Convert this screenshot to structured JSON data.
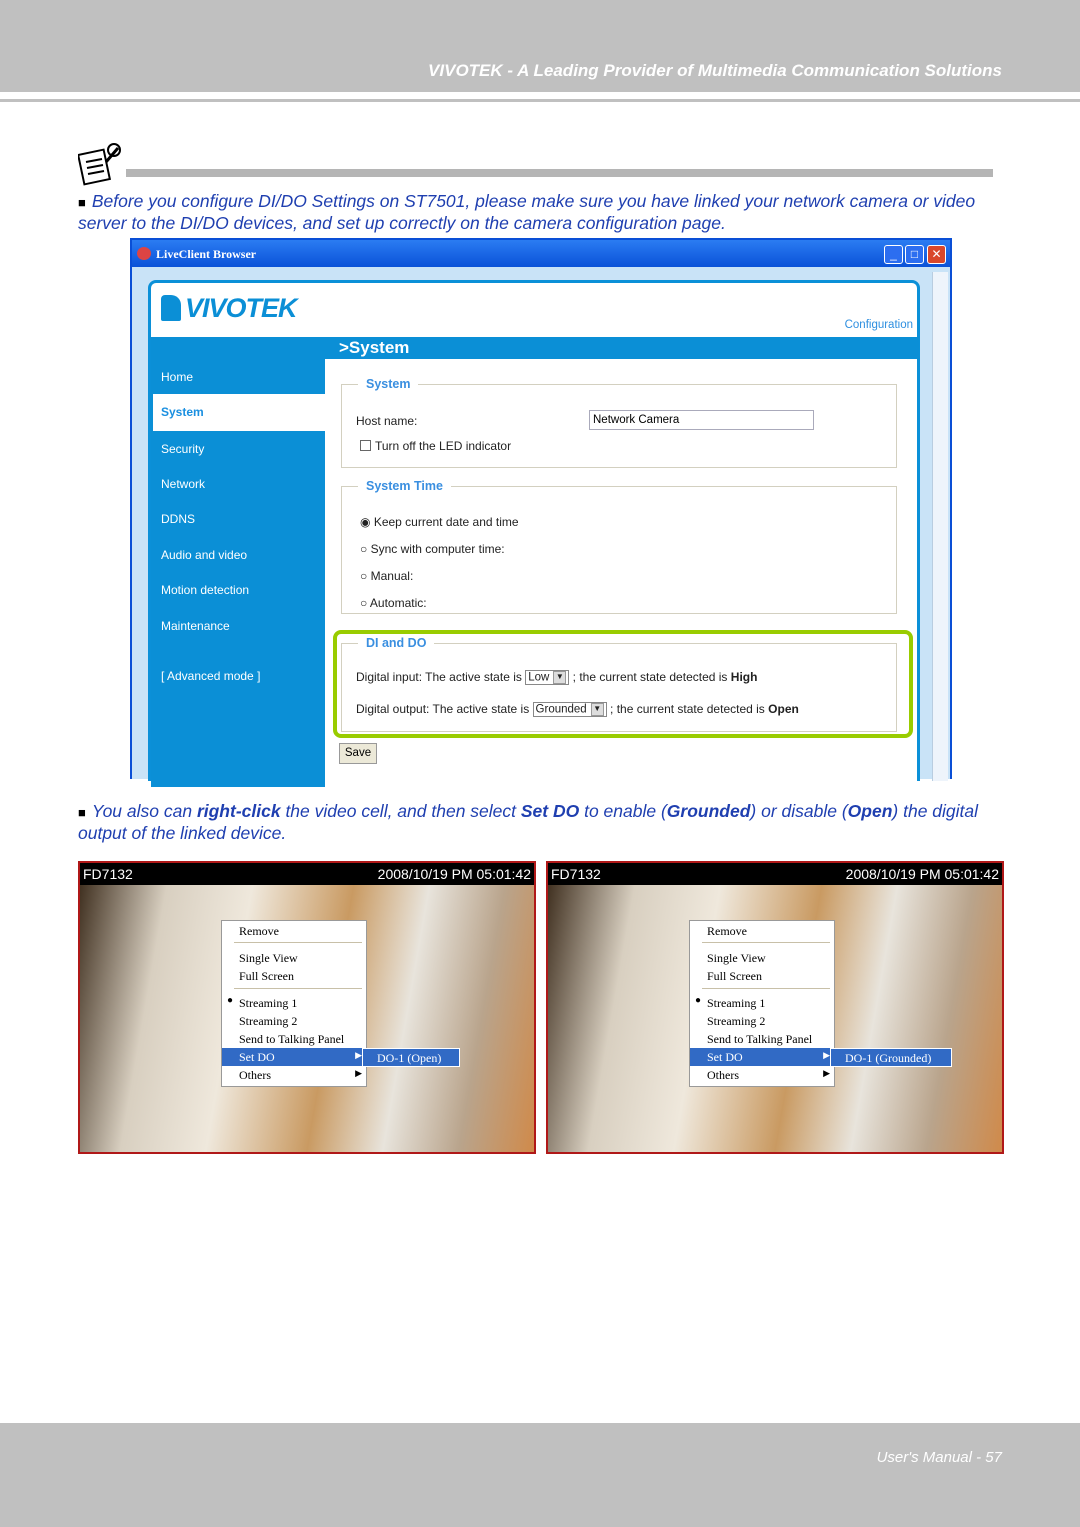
{
  "header": {
    "title": "VIVOTEK - A Leading Provider of Multimedia Communication Solutions"
  },
  "note1": "Before you configure DI/DO Settings on ST7501, please make sure you have linked your network camera or video server to the DI/DO devices, and set up correctly on the camera configuration page.",
  "browser": {
    "title": "LiveClient Browser",
    "logo": "VIVOTEK",
    "config_link": "Configuration",
    "page_title": ">System",
    "nav": [
      {
        "label": "Home"
      },
      {
        "label": "System",
        "active": true
      },
      {
        "label": "Security"
      },
      {
        "label": "Network"
      },
      {
        "label": "DDNS"
      },
      {
        "label": "Audio and video"
      },
      {
        "label": "Motion detection"
      },
      {
        "label": "Maintenance"
      },
      {
        "label": "[ Advanced mode ]"
      }
    ],
    "system": {
      "legend": "System",
      "host_label": "Host name:",
      "host_value": "Network Camera",
      "led_label": "Turn off the LED indicator",
      "led_checked": false
    },
    "time": {
      "legend": "System Time",
      "options": [
        "Keep current date and time",
        "Sync with computer time:",
        "Manual:",
        "Automatic:"
      ],
      "selected": 0
    },
    "dido": {
      "legend": "DI and DO",
      "di_prefix": "Digital input: The active state is",
      "di_value": "Low",
      "di_suffix": "; the current state detected is",
      "di_state": "High",
      "do_prefix": "Digital output: The active state is",
      "do_value": "Grounded",
      "do_suffix": "; the current state detected is",
      "do_state": "Open",
      "highlight": "#99cc00"
    },
    "save": "Save"
  },
  "note2": {
    "t1": "You also can ",
    "b1": "right-click",
    "t2": " the video cell, and then select ",
    "b2": "Set DO",
    "t3": " to enable (",
    "b3": "Grounded",
    "t4": ") or disable (",
    "b4": "Open",
    "t5": ") the digital output of the linked device."
  },
  "cams": [
    {
      "name": "FD7132",
      "time": "2008/10/19 PM 05:01:42",
      "menu": [
        "Remove",
        "Single View",
        "Full Screen",
        "Streaming 1",
        "Streaming 2",
        "Send to Talking Panel",
        "Set DO",
        "Others"
      ],
      "submenu": "DO-1 (Open)"
    },
    {
      "name": "FD7132",
      "time": "2008/10/19 PM 05:01:42",
      "menu": [
        "Remove",
        "Single View",
        "Full Screen",
        "Streaming 1",
        "Streaming 2",
        "Send to Talking Panel",
        "Set DO",
        "Others"
      ],
      "submenu": "DO-1 (Grounded)"
    }
  ],
  "footer": "User's Manual - 57"
}
